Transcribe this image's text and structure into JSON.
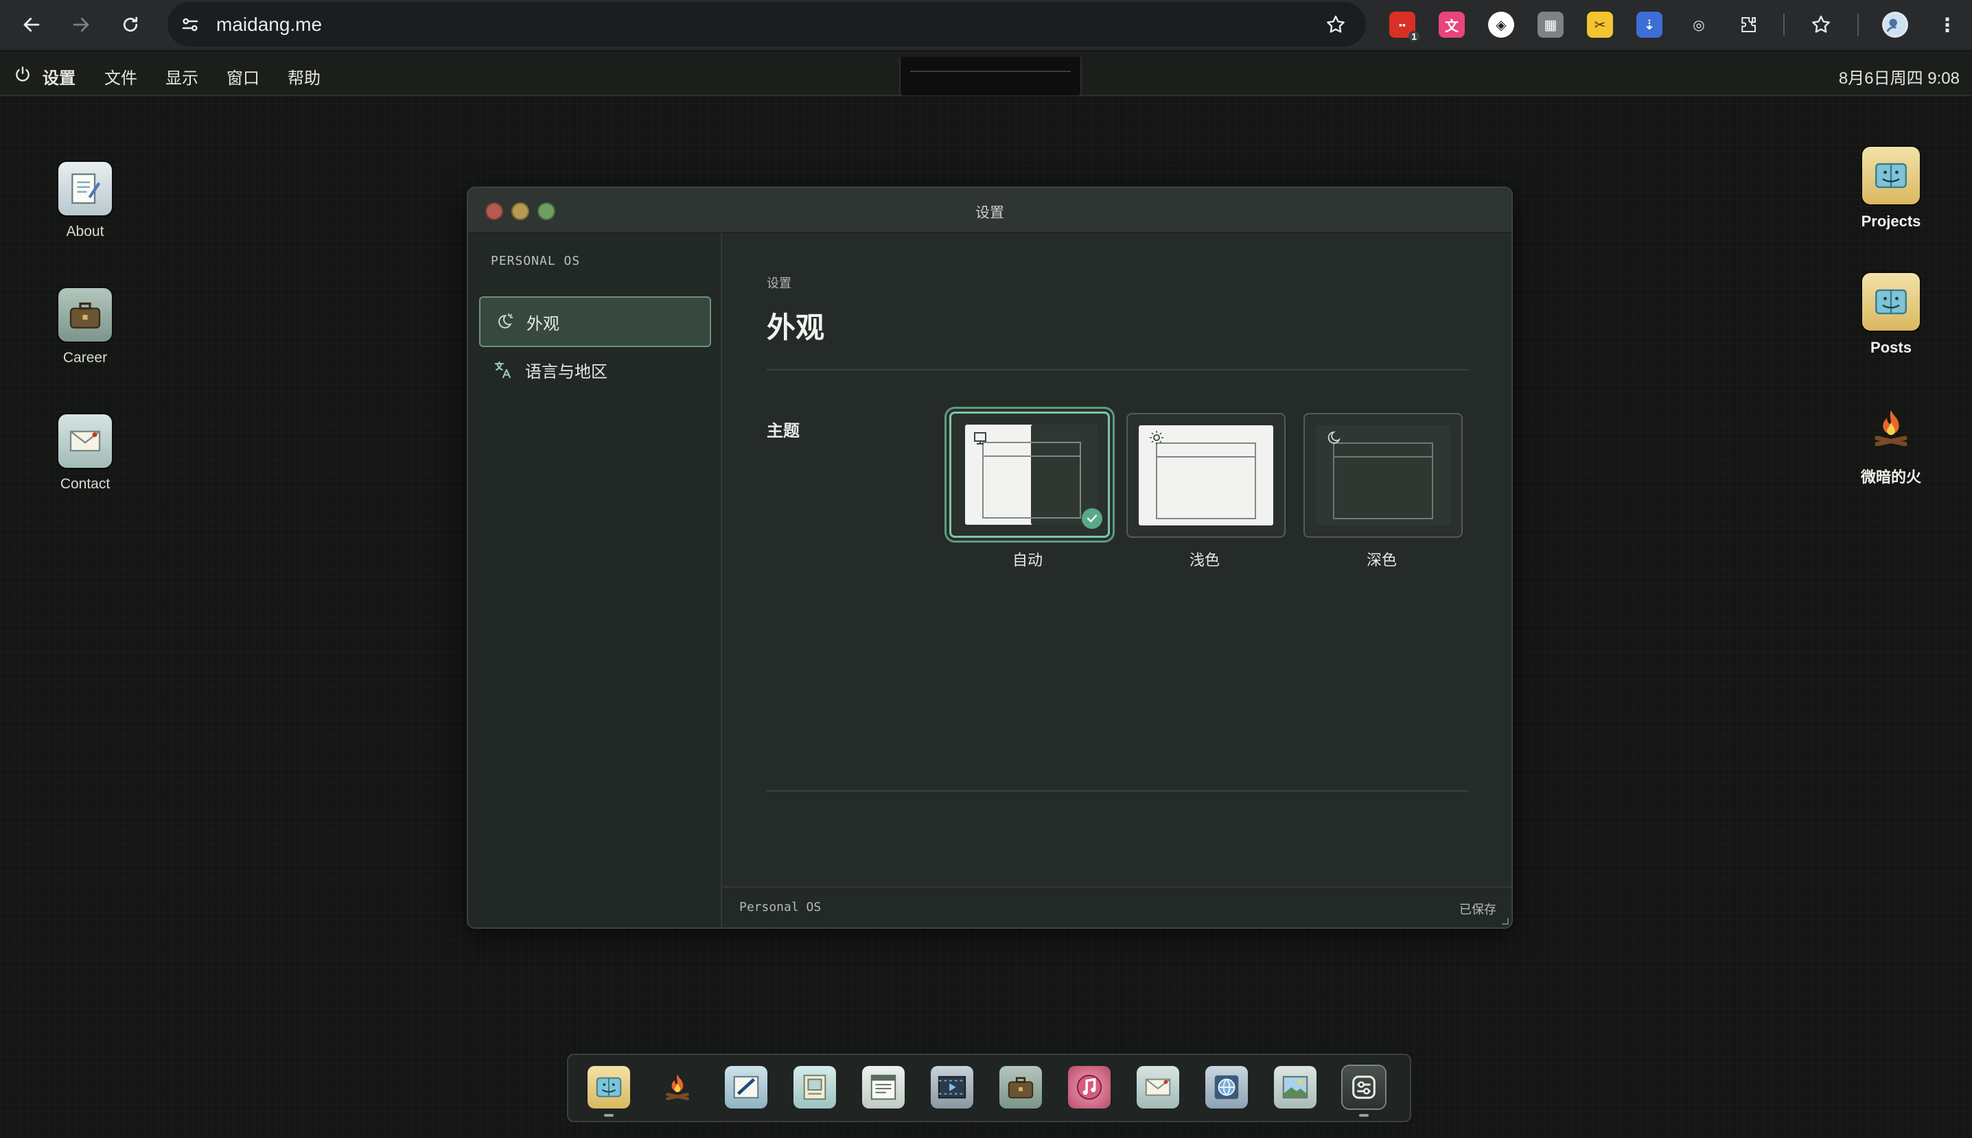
{
  "browser": {
    "url": "maidang.me",
    "extension_badge": "1"
  },
  "menubar": {
    "app_name": "设置",
    "items": [
      "文件",
      "显示",
      "窗口",
      "帮助"
    ],
    "clock": "8月6日周四 9:08"
  },
  "desktop": {
    "left_icons": [
      {
        "label": "About",
        "icon": "notepad-icon"
      },
      {
        "label": "Career",
        "icon": "briefcase-icon"
      },
      {
        "label": "Contact",
        "icon": "mail-icon"
      }
    ],
    "right_icons": [
      {
        "label": "Projects",
        "icon": "finder-folder-icon"
      },
      {
        "label": "Posts",
        "icon": "finder-folder-icon"
      },
      {
        "label": "微暗的火",
        "icon": "campfire-icon"
      }
    ]
  },
  "window": {
    "title": "设置",
    "sidebar": {
      "heading": "PERSONAL OS",
      "items": [
        {
          "label": "外观",
          "icon": "appearance-icon",
          "active": true
        },
        {
          "label": "语言与地区",
          "icon": "translate-icon",
          "active": false
        }
      ]
    },
    "content": {
      "breadcrumb": "设置",
      "title": "外观",
      "theme_label": "主题",
      "themes": [
        {
          "name": "自动",
          "selected": true
        },
        {
          "name": "浅色",
          "selected": false
        },
        {
          "name": "深色",
          "selected": false
        }
      ]
    },
    "footer": {
      "left": "Personal OS",
      "right": "已保存"
    }
  },
  "dock": {
    "items": [
      "finder-icon",
      "campfire-icon",
      "drawing-icon",
      "preview-icon",
      "text-editor-icon",
      "video-player-icon",
      "briefcase-icon",
      "music-icon",
      "mail-icon",
      "globe-icon",
      "photos-icon",
      "settings-icon"
    ]
  },
  "colors": {
    "accent": "#7cc8a7",
    "window_bg": "#252b28",
    "desktop_bg": "#141614"
  }
}
